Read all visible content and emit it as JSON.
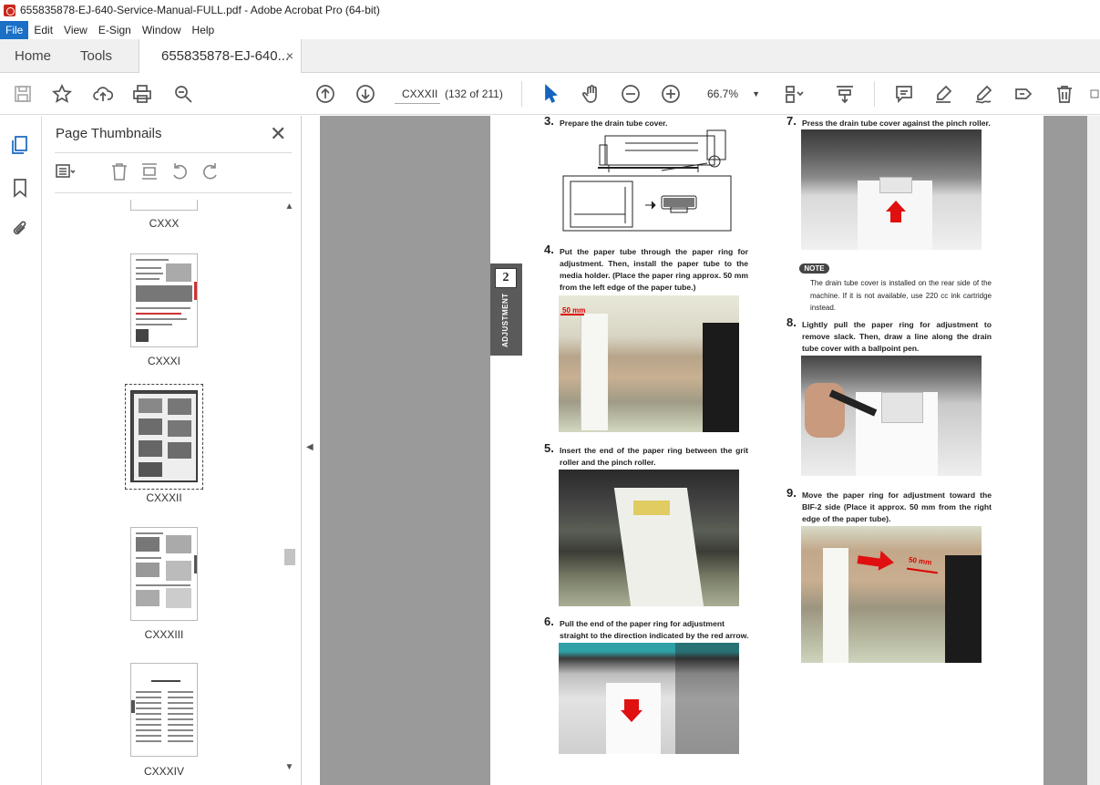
{
  "window": {
    "title": "655835878-EJ-640-Service-Manual-FULL.pdf - Adobe Acrobat Pro (64-bit)"
  },
  "menu": {
    "items": [
      "File",
      "Edit",
      "View",
      "E-Sign",
      "Window",
      "Help"
    ]
  },
  "tabs": {
    "home": "Home",
    "tools": "Tools",
    "document": "655835878-EJ-640...",
    "close": "×"
  },
  "toolbar": {
    "page_label": "CXXXII",
    "page_count": "(132 of 211)",
    "zoom": "66.7%",
    "zoom_caret": "▼"
  },
  "thumbnails": {
    "title": "Page Thumbnails",
    "close": "✕",
    "pages": [
      "CXXX",
      "CXXXI",
      "CXXXII",
      "CXXXIII",
      "CXXXIV"
    ],
    "selected": "CXXXII"
  },
  "document_page": {
    "chapter_number": "2",
    "chapter_tab": "ADJUSTMENT",
    "steps": [
      {
        "num": "3.",
        "text": "Prepare the drain tube cover."
      },
      {
        "num": "4.",
        "text": "Put the paper tube through the paper ring for adjustment. Then, install the paper tube to the media holder. (Place the paper ring approx. 50 mm from the left edge of the paper tube.)"
      },
      {
        "num": "5.",
        "text": "Insert the end of the paper ring between the grit roller and the pinch roller."
      },
      {
        "num": "6.",
        "text": "Pull the end of the paper ring for adjustment straight to the direction indicated by the red arrow."
      },
      {
        "num": "7.",
        "text": "Press the drain tube cover against the pinch roller."
      },
      {
        "num": "8.",
        "text": "Lightly pull the paper ring for adjustment to remove slack. Then, draw a line along the drain tube cover with a ballpoint pen."
      },
      {
        "num": "9.",
        "text": "Move the paper ring for adjustment toward the BIF-2 side (Place it approx. 50 mm from the right edge of the paper tube)."
      }
    ],
    "note_label": "NOTE",
    "note_text": "The drain tube cover is installed on the rear side of the machine. If it is not available, use 220 cc ink cartridge instead.",
    "photo_label_50mm": "50 mm"
  }
}
